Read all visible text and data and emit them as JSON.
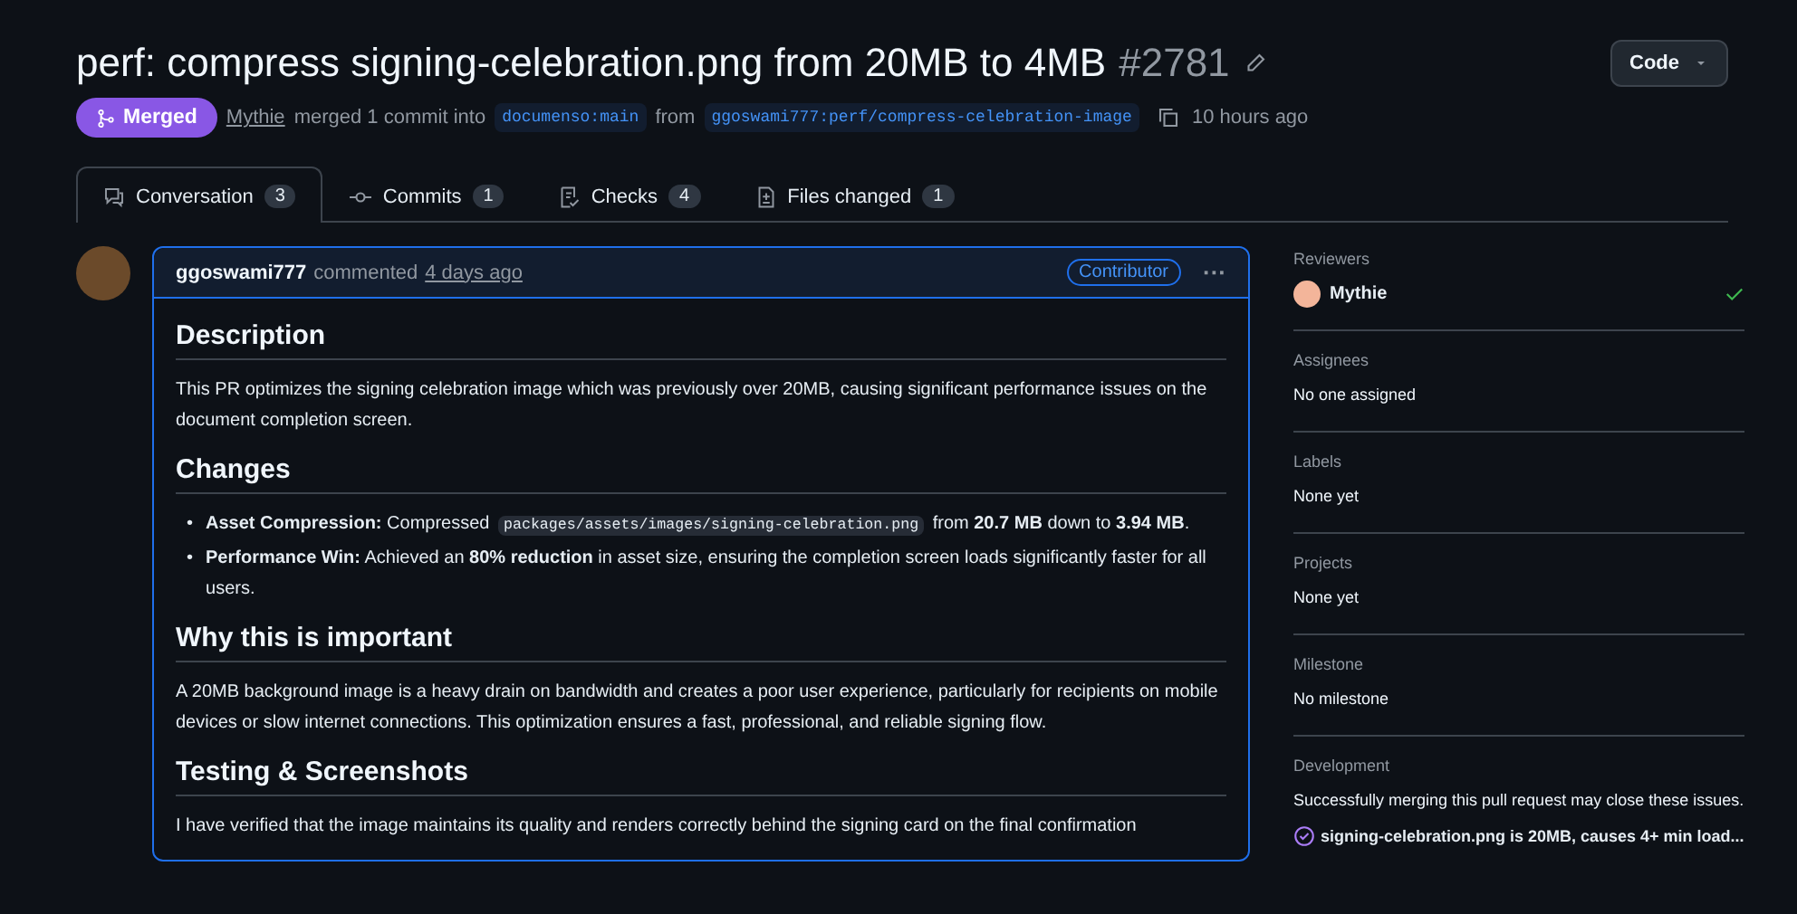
{
  "header": {
    "title": "perf: compress signing-celebration.png from 20MB to 4MB",
    "number": "#2781",
    "code_button": "Code",
    "state": {
      "label": "Merged",
      "kind": "merged"
    },
    "author": "Mythie",
    "action": "merged 1 commit into",
    "base": "documenso:main",
    "from": "from",
    "head": "ggoswami777:perf/compress-celebration-image",
    "time": "10 hours ago"
  },
  "tabs": [
    {
      "label": "Conversation",
      "count": "3",
      "kind": "conversation",
      "selected": true
    },
    {
      "label": "Commits",
      "count": "1",
      "kind": "commit",
      "selected": false
    },
    {
      "label": "Checks",
      "count": "4",
      "kind": "checks",
      "selected": false
    },
    {
      "label": "Files changed",
      "count": "1",
      "kind": "file",
      "selected": false
    }
  ],
  "comment": {
    "author": "ggoswami777",
    "action": "commented",
    "time": "4 days ago",
    "badge": "Contributor",
    "menu": "···",
    "body": [
      {
        "kind": "heading",
        "text": "Description"
      },
      {
        "kind": "paragraph",
        "text": "This PR optimizes the signing celebration image which was previously over 20MB, causing significant performance issues on the document completion screen."
      },
      {
        "kind": "heading",
        "text": "Changes"
      },
      {
        "kind": "list",
        "items": [
          {
            "bullet": "•",
            "before": "**Asset Compression:** Compressed",
            "code": "packages/assets/images/signing-celebration.png",
            "after": "from **20.7 MB** down to **3.94 MB**."
          },
          {
            "bullet": "•",
            "before": "**Performance Win:** Achieved an **80% reduction** in asset size, ensuring the completion screen loads significantly faster for all users."
          }
        ]
      },
      {
        "kind": "heading",
        "text": "Why this is important"
      },
      {
        "kind": "paragraph",
        "text": "A 20MB background image is a heavy drain on bandwidth and creates a poor user experience, particularly for recipients on mobile devices or slow internet connections. This optimization ensures a fast, professional, and reliable signing flow."
      },
      {
        "kind": "heading",
        "text": "Testing & Screenshots"
      },
      {
        "kind": "paragraph",
        "text": "I have verified that the image maintains its quality and renders correctly behind the signing card on the final confirmation"
      }
    ]
  },
  "sidebar": [
    {
      "title": "Reviewers",
      "kind": "reviewer",
      "name": "Mythie",
      "approved": true
    },
    {
      "title": "Assignees",
      "kind": "text",
      "text": "No one assigned"
    },
    {
      "title": "Labels",
      "kind": "text",
      "text": "None yet"
    },
    {
      "title": "Projects",
      "kind": "text",
      "text": "None yet"
    },
    {
      "title": "Milestone",
      "kind": "text",
      "text": "No milestone"
    },
    {
      "title": "Development",
      "kind": "development",
      "text": "Successfully merging this pull request may close these issues.",
      "issue": "signing-celebration.png is 20MB, causes 4+ min load..."
    }
  ]
}
